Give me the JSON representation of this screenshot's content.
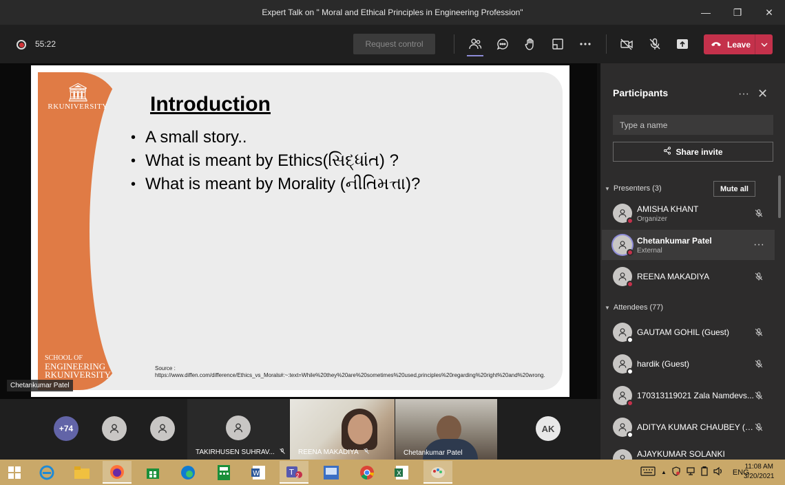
{
  "window": {
    "title": "Expert Talk on \" Moral and Ethical Principles in Engineering Profession\""
  },
  "toolbar": {
    "timer": "55:22",
    "request_control": "Request control",
    "leave_label": "Leave"
  },
  "slide": {
    "logo_top": "RKUNIVERSITY",
    "logo_bottom_1": "SCHOOL OF",
    "logo_bottom_2": "ENGINEERING",
    "logo_bottom_3": "RKUNIVERSITY",
    "title": "Introduction",
    "bullets": [
      "A small story..",
      "What is meant by Ethics(સિદ્ધાંત) ?",
      "What is meant by Morality (નીતિમત્તા)?"
    ],
    "source_label": "Source :",
    "source_url": "https://www.diffen.com/difference/Ethics_vs_Morals#:~:text=While%20they%20are%20sometimes%20used,principles%20regarding%20right%20and%20wrong."
  },
  "presenter_label": "Chetankumar Patel",
  "strip": {
    "overflow_count": "+74",
    "tiles": [
      {
        "name": "TAKIRHUSEN SUHRAV..."
      },
      {
        "name": "REENA MAKADIYA"
      },
      {
        "name": "Chetankumar Patel"
      }
    ],
    "initials": "AK"
  },
  "participants": {
    "title": "Participants",
    "search_placeholder": "Type a name",
    "share_invite": "Share invite",
    "presenters_label": "Presenters (3)",
    "mute_all": "Mute all",
    "presenters": [
      {
        "name": "AMISHA KHANT",
        "sub": "Organizer"
      },
      {
        "name": "Chetankumar Patel",
        "sub": "External"
      },
      {
        "name": "REENA MAKADIYA",
        "sub": ""
      }
    ],
    "attendees_label": "Attendees (77)",
    "attendees": [
      {
        "name": "GAUTAM GOHIL (Guest)"
      },
      {
        "name": "hardik (Guest)"
      },
      {
        "name": "170313119021 Zala Namdevs..."
      },
      {
        "name": "ADITYA KUMAR CHAUBEY (G..."
      },
      {
        "name": "AJAYKUMAR SOLANKI"
      }
    ]
  },
  "taskbar": {
    "lang": "ENG",
    "time": "11:08 AM",
    "date": "3/20/2021",
    "teams_badge": "2"
  },
  "colors": {
    "leave": "#c4314b",
    "accent": "#8e8cd8",
    "slide_orange": "#e07b45",
    "taskbar": "#c9a869"
  }
}
